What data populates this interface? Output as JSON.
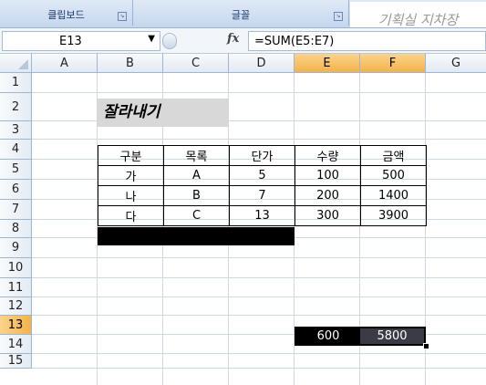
{
  "ribbon": {
    "groups": [
      {
        "label": "클립보드"
      },
      {
        "label": "글꼴"
      }
    ],
    "handwriting_text": "기획실 지차장"
  },
  "formula_bar": {
    "name_box": "E13",
    "fx_label": "fx",
    "formula": "=SUM(E5:E7)"
  },
  "columns": [
    "A",
    "B",
    "C",
    "D",
    "E",
    "F",
    "G"
  ],
  "selected_columns": [
    "E",
    "F"
  ],
  "rows": [
    "1",
    "2",
    "3",
    "4",
    "5",
    "6",
    "7",
    "8",
    "9",
    "10",
    "11",
    "12",
    "13",
    "14",
    "15"
  ],
  "selected_row": "13",
  "sheet": {
    "title": "잘라내기",
    "table": {
      "headers": [
        "구분",
        "목록",
        "단가",
        "수량",
        "금액"
      ],
      "rows": [
        [
          "가",
          "A",
          "5",
          "100",
          "500"
        ],
        [
          "나",
          "B",
          "7",
          "200",
          "1400"
        ],
        [
          "다",
          "C",
          "13",
          "300",
          "3900"
        ]
      ]
    },
    "selection": {
      "e13": "600",
      "f13": "5800"
    }
  },
  "colors": {
    "selected_header": "#f4b24a",
    "grid_line": "#d0d7e5",
    "title_fill": "#d8d8d8"
  }
}
